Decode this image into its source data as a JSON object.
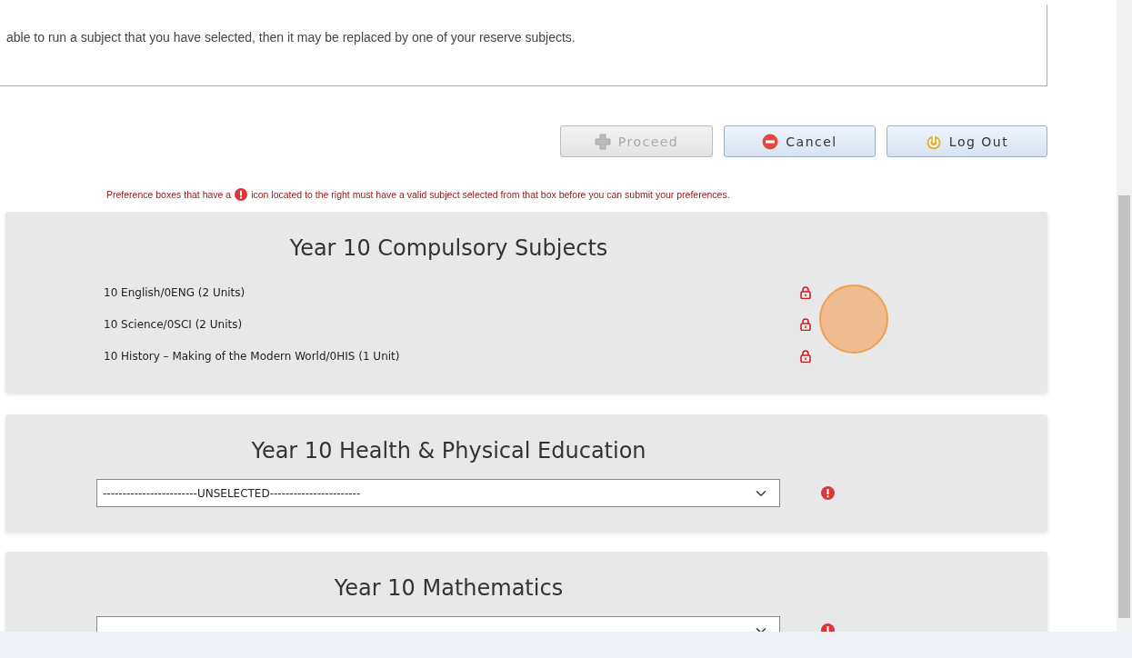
{
  "intro_text": "able to run a subject that you have selected, then it may be replaced by one of your reserve subjects.",
  "buttons": [
    {
      "label": "Proceed",
      "kind": "proceed",
      "disabled": true
    },
    {
      "label": "Cancel",
      "kind": "cancel",
      "disabled": false
    },
    {
      "label": "Log Out",
      "kind": "logout",
      "disabled": false
    }
  ],
  "notice": {
    "before": "Preference boxes that have a",
    "after": "icon located to the right must have a valid subject selected from that box before you can submit your preferences."
  },
  "sections": [
    {
      "title": "Year 10 Compulsory Subjects",
      "kind": "list",
      "subjects": [
        {
          "name": "10 English/0ENG (2 Units)",
          "locked": true
        },
        {
          "name": "10 Science/0SCI (2 Units)",
          "locked": true
        },
        {
          "name": "10 History – Making of the Modern World/0HIS (1 Unit)",
          "locked": true
        }
      ]
    },
    {
      "title": "Year 10 Health & Physical Education",
      "kind": "select",
      "value": "------------------------UNSELECTED-----------------------",
      "required": true
    },
    {
      "title": "Year 10 Mathematics",
      "kind": "select",
      "required": true
    }
  ]
}
